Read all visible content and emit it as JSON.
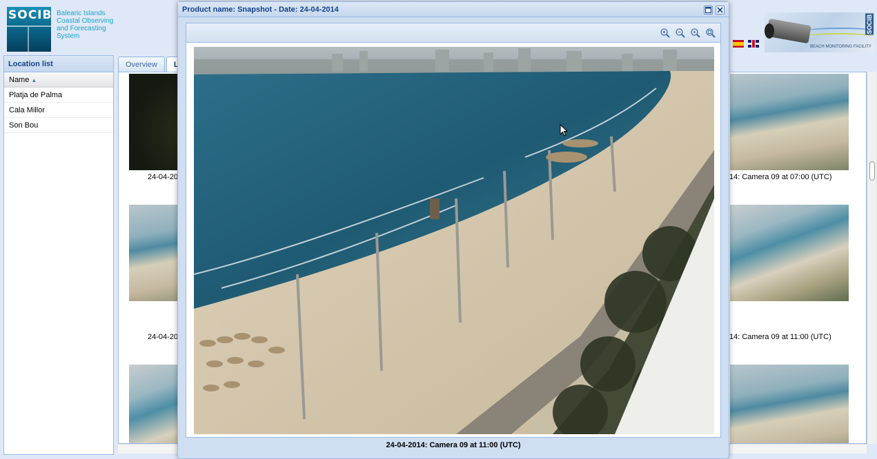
{
  "header": {
    "brand": "SOCIB",
    "org_lines": [
      "Balearic Islands",
      "Coastal Observing",
      "and Forecasting",
      "System"
    ],
    "facility_badge": "SOCIB",
    "facility_caption": "BEACH MONITORING FACILITY",
    "languages": [
      "es",
      "en"
    ]
  },
  "location_panel": {
    "title": "Location list",
    "column_header": "Name",
    "items": [
      "Platja de Palma",
      "Cala Millor",
      "Son Bou"
    ]
  },
  "tabs": [
    {
      "label": "Overview",
      "active": false
    },
    {
      "label": "L",
      "active": true
    }
  ],
  "gallery": {
    "captions_left": [
      "24-04-20",
      "24-04-20"
    ],
    "captions_right": [
      "14: Camera 09 at 07:00 (UTC)",
      "14: Camera 09 at 11:00 (UTC)"
    ]
  },
  "modal": {
    "title": "Product name: Snapshot - Date: 24-04-2014",
    "caption": "24-04-2014: Camera 09 at 11:00 (UTC)",
    "zoom_tools": [
      "zoom-in-icon",
      "zoom-out-icon",
      "zoom-reset-icon",
      "zoom-fit-icon"
    ]
  },
  "colors": {
    "panel_title": "#15428b",
    "border": "#99bbe8",
    "background": "#dfe8f6",
    "brand": "#1aa5c8"
  }
}
